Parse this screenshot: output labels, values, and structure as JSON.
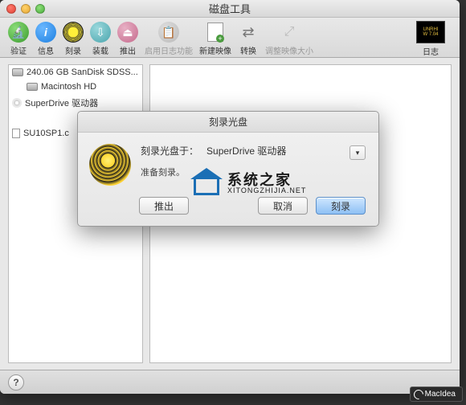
{
  "window": {
    "title": "磁盘工具"
  },
  "toolbar": {
    "items": [
      {
        "label": "验证"
      },
      {
        "label": "信息"
      },
      {
        "label": "刻录"
      },
      {
        "label": "装载"
      },
      {
        "label": "推出"
      },
      {
        "label": "启用日志功能"
      },
      {
        "label": "新建映像"
      },
      {
        "label": "转换"
      },
      {
        "label": "调整映像大小"
      }
    ],
    "log_label": "日志",
    "log_badge_top": "UNRHI",
    "log_badge_bottom": "W 7.04"
  },
  "sidebar": {
    "items": [
      {
        "label": "240.06 GB SanDisk SDSS...",
        "indent": false,
        "icon": "hdd"
      },
      {
        "label": "Macintosh HD",
        "indent": true,
        "icon": "hdd"
      },
      {
        "label": "SuperDrive 驱动器",
        "indent": false,
        "icon": "disc"
      },
      {
        "label": "SU10SP1.c",
        "indent": false,
        "icon": "file"
      }
    ]
  },
  "sheet": {
    "title": "刻录光盘",
    "burn_to_label": "刻录光盘于：",
    "drive": "SuperDrive 驱动器",
    "preparing": "准备刻录。",
    "eject_btn": "推出",
    "cancel_btn": "取消",
    "burn_btn": "刻录"
  },
  "watermark": {
    "cn": "系统之家",
    "en": "XITONGZHIJIA.NET"
  },
  "badge": "MacIdea"
}
